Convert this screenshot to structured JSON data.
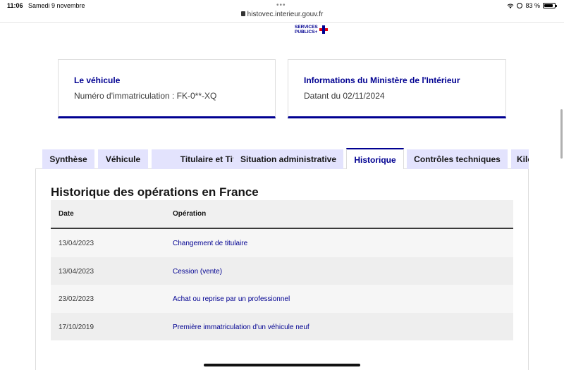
{
  "status_bar": {
    "time": "11:06",
    "date": "Samedi 9 novembre",
    "url": "histovec.interieur.gouv.fr",
    "battery": "83 %"
  },
  "logo": {
    "line1": "SERVICES",
    "line2": "PUBLICS+"
  },
  "cards": {
    "vehicle": {
      "title": "Le véhicule",
      "text": "Numéro d'immatriculation : FK-0**-XQ"
    },
    "ministry": {
      "title": "Informations du Ministère de l'Intérieur",
      "text": "Datant du 02/11/2024"
    }
  },
  "tabs": [
    {
      "label": "Synthèse"
    },
    {
      "label": "Véhicule"
    },
    {
      "label": "Titulaire et Titre"
    },
    {
      "label": "Situation administrative"
    },
    {
      "label": "Historique"
    },
    {
      "label": "Contrôles techniques"
    },
    {
      "label": "Kilo"
    }
  ],
  "active_tab": "Historique",
  "section": {
    "title": "Historique des opérations en France"
  },
  "table": {
    "headers": {
      "date": "Date",
      "operation": "Opération"
    },
    "rows": [
      {
        "date": "13/04/2023",
        "operation": "Changement de titulaire"
      },
      {
        "date": "13/04/2023",
        "operation": "Cession (vente)"
      },
      {
        "date": "23/02/2023",
        "operation": "Achat ou reprise par un professionnel"
      },
      {
        "date": "17/10/2019",
        "operation": "Première immatriculation d'un véhicule neuf"
      }
    ]
  },
  "colors": {
    "accent": "#000091",
    "tab_background": "#e3e3fd",
    "marianne_red": "#e1000f"
  }
}
